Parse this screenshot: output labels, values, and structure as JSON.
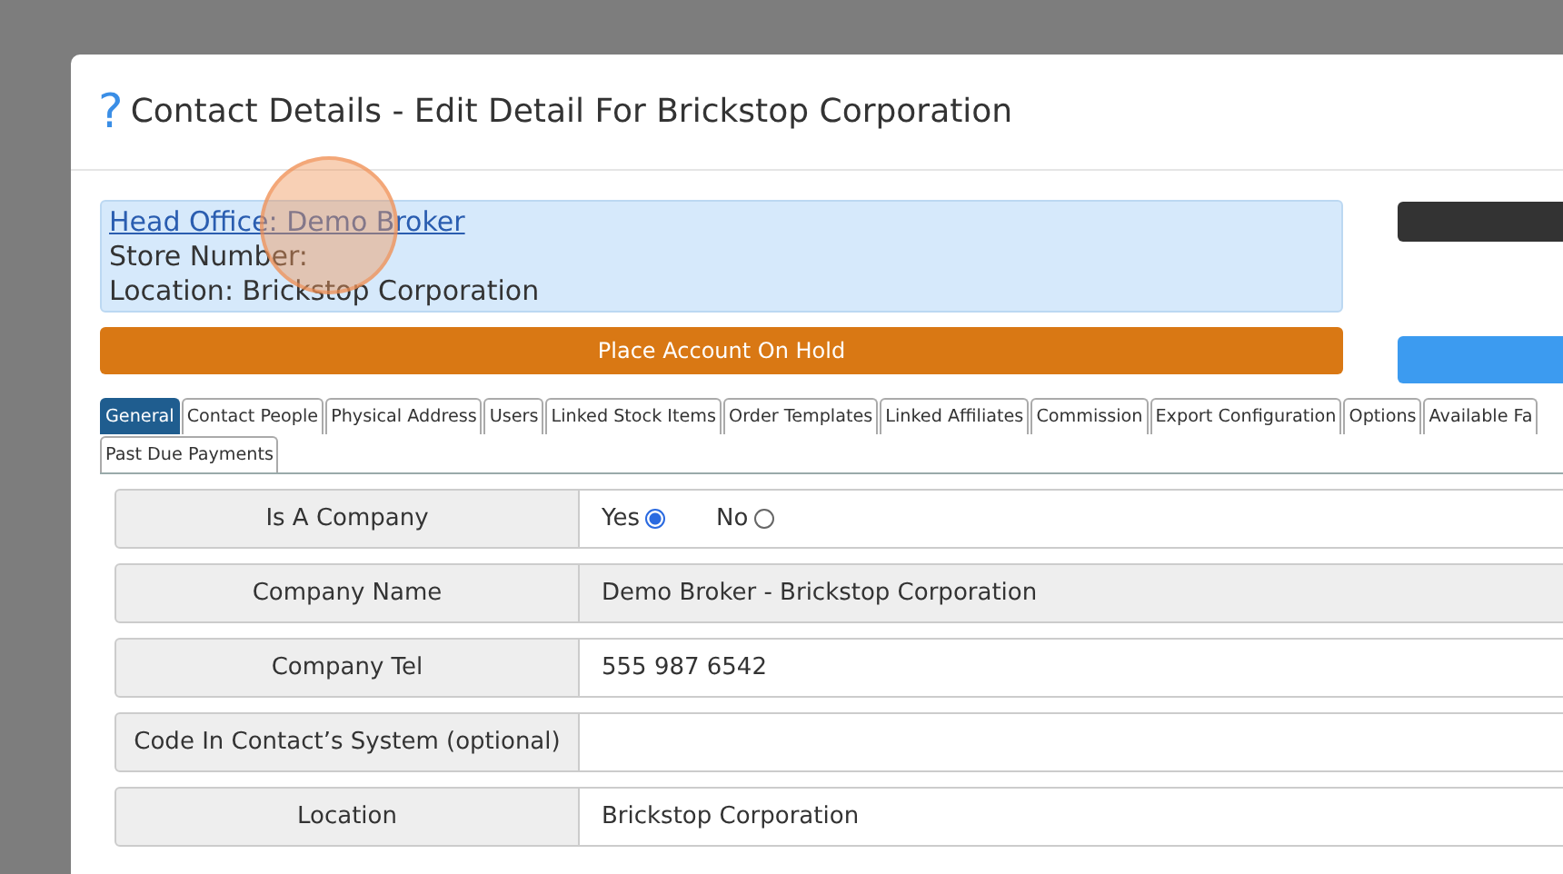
{
  "dialog": {
    "help": "?",
    "title": "Contact Details - Edit Detail For Brickstop Corporation"
  },
  "summary": {
    "head_office": "Head Office: Demo Broker",
    "store_number": "Store Number:",
    "location": "Location: Brickstop Corporation"
  },
  "hold_button": {
    "label": "Place Account On Hold"
  },
  "tabs": [
    {
      "label": "General",
      "selected": true
    },
    {
      "label": "Contact People",
      "selected": false
    },
    {
      "label": "Physical Address",
      "selected": false
    },
    {
      "label": "Users",
      "selected": false
    },
    {
      "label": "Linked Stock Items",
      "selected": false
    },
    {
      "label": "Order Templates",
      "selected": false
    },
    {
      "label": "Linked Affiliates",
      "selected": false
    },
    {
      "label": "Commission",
      "selected": false
    },
    {
      "label": "Export Configuration",
      "selected": false
    },
    {
      "label": "Options",
      "selected": false
    },
    {
      "label": "Available Fa",
      "selected": false
    },
    {
      "label": "Past Due Payments",
      "selected": false
    }
  ],
  "fields": [
    {
      "kind": "radio",
      "label": "Is A Company",
      "options": [
        {
          "label": "Yes",
          "selected": true
        },
        {
          "label": "No",
          "selected": false
        }
      ]
    },
    {
      "kind": "readonly",
      "label": "Company Name",
      "value": "Demo Broker - Brickstop Corporation"
    },
    {
      "kind": "text",
      "label": "Company Tel",
      "value": "555 987 6542"
    },
    {
      "kind": "text",
      "label": "Code In Contact’s System (optional)"
    },
    {
      "kind": "text",
      "label": "Location",
      "value": "Brickstop Corporation"
    }
  ]
}
